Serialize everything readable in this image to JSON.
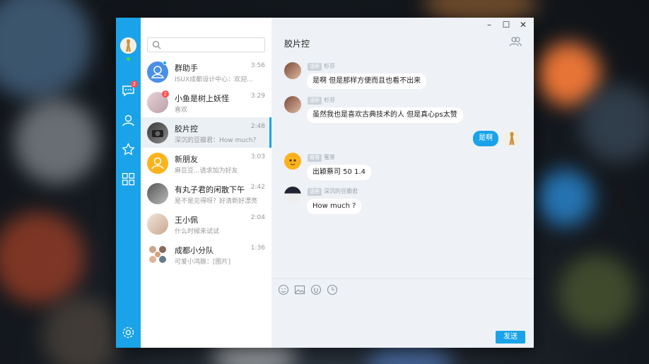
{
  "window": {
    "controls": {
      "minimize": "–",
      "maximize": "☐",
      "close": "✕"
    }
  },
  "sidebar": {
    "chat_badge": "2",
    "icons": [
      "chat-icon",
      "contacts-icon",
      "favorites-icon",
      "apps-icon",
      "settings-icon"
    ]
  },
  "search": {
    "placeholder": ""
  },
  "contacts": [
    {
      "name": "群助手",
      "preview": "ISUX成都设计中心：欢迎...",
      "time": "3:56"
    },
    {
      "name": "小鱼是树上妖怪",
      "preview": "喜欢",
      "time": "3:29",
      "badge": "2"
    },
    {
      "name": "胶片控",
      "preview": "深沉的豆瓣君：How much？",
      "time": "2:48",
      "active": true
    },
    {
      "name": "新朋友",
      "preview": "麻豆豆...请求加为好友",
      "time": "3:03"
    },
    {
      "name": "有丸子君的闲散下午",
      "preview": "是不是见得呀？好清新好漂亮",
      "time": "2:42"
    },
    {
      "name": "王小佩",
      "preview": "什么时候来试试",
      "time": "2:04"
    },
    {
      "name": "成都小分队",
      "preview": "可爱小鸿豚：[图片]",
      "time": "1:36"
    }
  ],
  "chat": {
    "title": "胶片控",
    "messages": [
      {
        "tag": "话痨",
        "sender": "杉芬",
        "text": "是啊 但是那样方便而且也看不出来"
      },
      {
        "tag": "话痨",
        "sender": "杉芬",
        "text": "虽然我也是喜欢古典技术的人 但是真心ps太赞"
      },
      {
        "mine": true,
        "text": "是啊"
      },
      {
        "tag": "哥哥",
        "sender": "蜜茶",
        "text": "出颖蔡司 50 1.4"
      },
      {
        "tag": "话痨",
        "sender": "深沉的豆瓣君",
        "text": "How much ?"
      }
    ],
    "tools": [
      "emoji-icon",
      "image-icon",
      "file-icon",
      "history-icon"
    ],
    "send_label": "发送"
  },
  "colors": {
    "accent": "#1aa3e8",
    "badge": "#ff4d4f",
    "online": "#4ad34a"
  }
}
